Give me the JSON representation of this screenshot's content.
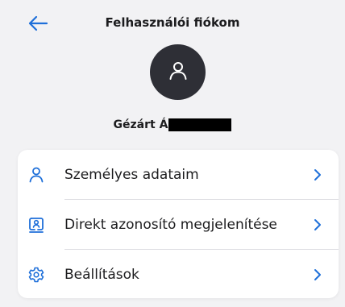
{
  "header": {
    "title": "Felhasználói fiókom",
    "back_icon": "arrow-left-icon"
  },
  "profile": {
    "avatar_icon": "person-icon",
    "name": "Gézárt Á",
    "name_redacted": true
  },
  "menu": {
    "items": [
      {
        "label": "Személyes adataim",
        "icon": "person-outline-icon"
      },
      {
        "label": "Direkt azonosító megjelenítése",
        "icon": "id-card-icon"
      },
      {
        "label": "Beállítások",
        "icon": "gear-icon"
      }
    ],
    "chevron_icon": "chevron-right-icon"
  },
  "colors": {
    "accent": "#1e6fd9",
    "avatar_bg": "#2e2f36",
    "background": "#f2f2f4",
    "card": "#ffffff",
    "text": "#1c1c1e"
  }
}
